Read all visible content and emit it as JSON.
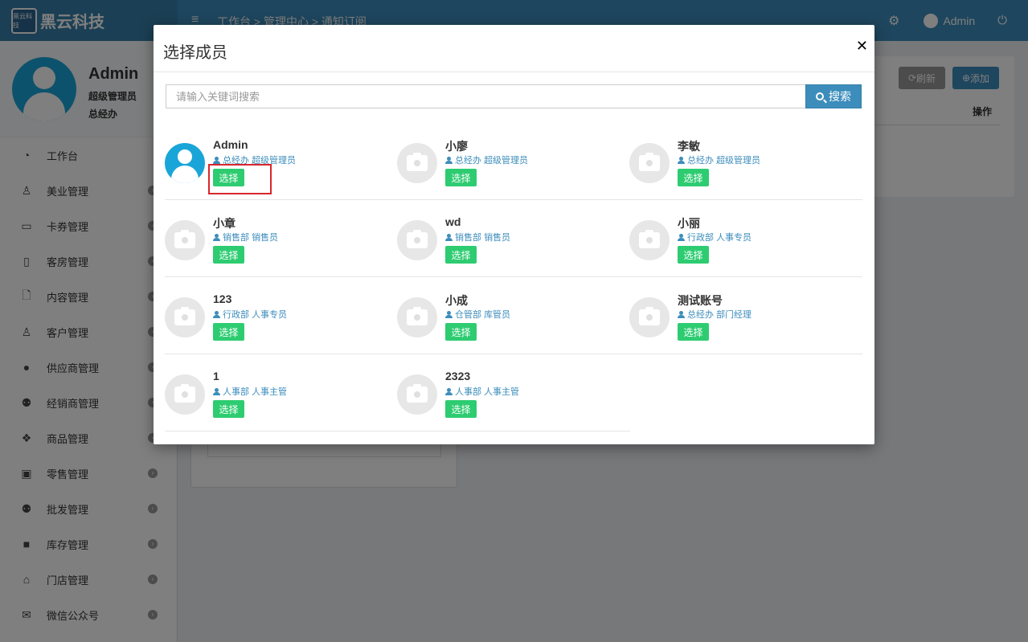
{
  "app": {
    "brand_logo_text": "黑云科技",
    "brand_name": "黑云科技",
    "breadcrumb": "工作台 > 管理中心 > 通知订阅",
    "top_user": "Admin"
  },
  "sidebar": {
    "user": {
      "name": "Admin",
      "role": "超级管理员",
      "dept": "总经办"
    },
    "items": [
      {
        "label": "工作台",
        "icon": "dashboard-icon"
      },
      {
        "label": "美业管理",
        "icon": "person-icon"
      },
      {
        "label": "卡券管理",
        "icon": "card-icon"
      },
      {
        "label": "客房管理",
        "icon": "building-icon"
      },
      {
        "label": "内容管理",
        "icon": "file-icon"
      },
      {
        "label": "客户管理",
        "icon": "male-icon"
      },
      {
        "label": "供应商管理",
        "icon": "user-icon"
      },
      {
        "label": "经销商管理",
        "icon": "users-icon"
      },
      {
        "label": "商品管理",
        "icon": "cubes-icon"
      },
      {
        "label": "零售管理",
        "icon": "money-icon"
      },
      {
        "label": "批发管理",
        "icon": "group-icon"
      },
      {
        "label": "库存管理",
        "icon": "archive-icon"
      },
      {
        "label": "门店管理",
        "icon": "home-icon"
      },
      {
        "label": "微信公众号",
        "icon": "wechat-icon"
      }
    ]
  },
  "page": {
    "refresh_label": "刷新",
    "add_label": "添加",
    "column_op": "操作"
  },
  "modal": {
    "title": "选择成员",
    "search_placeholder": "请输入关键词搜索",
    "search_button": "搜索",
    "select_label": "选择",
    "members": [
      {
        "name": "Admin",
        "dept": "总经办",
        "role": "超级管理员",
        "avatar": "user"
      },
      {
        "name": "小廖",
        "dept": "总经办",
        "role": "超级管理员",
        "avatar": "placeholder"
      },
      {
        "name": "李敏",
        "dept": "总经办",
        "role": "超级管理员",
        "avatar": "placeholder"
      },
      {
        "name": "小章",
        "dept": "销售部",
        "role": "销售员",
        "avatar": "placeholder"
      },
      {
        "name": "wd",
        "dept": "销售部",
        "role": "销售员",
        "avatar": "placeholder"
      },
      {
        "name": "小丽",
        "dept": "行政部",
        "role": "人事专员",
        "avatar": "placeholder"
      },
      {
        "name": "123",
        "dept": "行政部",
        "role": "人事专员",
        "avatar": "placeholder"
      },
      {
        "name": "小成",
        "dept": "仓管部",
        "role": "库管员",
        "avatar": "placeholder"
      },
      {
        "name": "测试账号",
        "dept": "总经办",
        "role": "部门经理",
        "avatar": "placeholder"
      },
      {
        "name": "1",
        "dept": "人事部",
        "role": "人事主管",
        "avatar": "placeholder"
      },
      {
        "name": "2323",
        "dept": "人事部",
        "role": "人事主管",
        "avatar": "placeholder"
      }
    ]
  }
}
